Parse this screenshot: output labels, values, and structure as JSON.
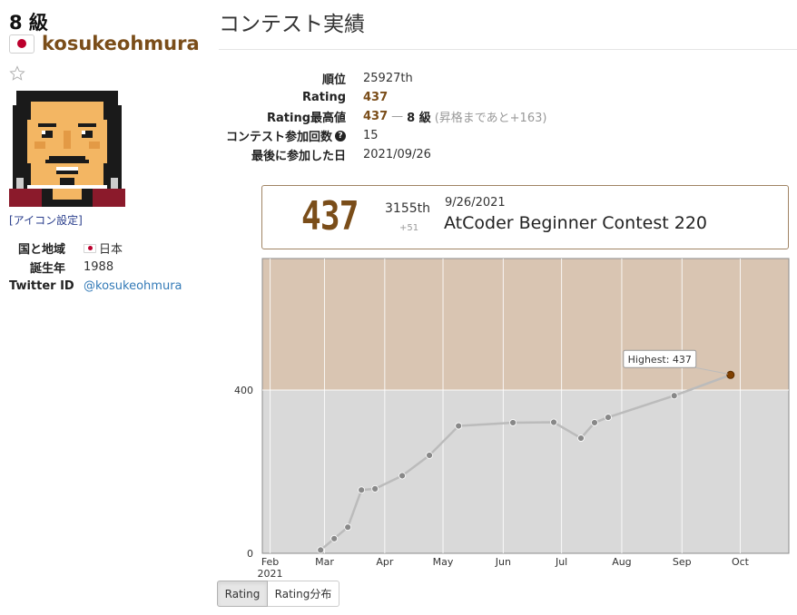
{
  "profile": {
    "grade": "8 級",
    "username": "kosukeohmura",
    "icon_setting_label": "[アイコン設定]",
    "fields": [
      {
        "key": "国と地域",
        "value": "日本",
        "flag": true
      },
      {
        "key": "誕生年",
        "value": "1988"
      },
      {
        "key": "Twitter ID",
        "value": "@kosukeohmura",
        "link": true
      }
    ]
  },
  "page": {
    "title": "コンテスト実績"
  },
  "stats": {
    "rank_label": "順位",
    "rank_value": "25927th",
    "rating_label": "Rating",
    "rating_value": "437",
    "max_label": "Rating最高値",
    "max_value": "437",
    "max_dash": "—",
    "max_grade": "8 級",
    "max_note": "(昇格まであと+163)",
    "count_label": "コンテスト参加回数",
    "count_value": "15",
    "last_label": "最後に参加した日",
    "last_value": "2021/09/26"
  },
  "info_box": {
    "rating": "437",
    "place": "3155th",
    "diff": "+51",
    "date": "9/26/2021",
    "contest": "AtCoder Beginner Contest 220"
  },
  "tabs": [
    {
      "label": "Rating",
      "active": true
    },
    {
      "label": "Rating分布",
      "active": false
    }
  ],
  "chart_data": {
    "type": "line",
    "x_ticks": [
      {
        "date": "2021-02-01",
        "label": "Feb",
        "sublabel": "2021"
      },
      {
        "date": "2021-03-01",
        "label": "Mar"
      },
      {
        "date": "2021-04-01",
        "label": "Apr"
      },
      {
        "date": "2021-05-01",
        "label": "May"
      },
      {
        "date": "2021-06-01",
        "label": "Jun"
      },
      {
        "date": "2021-07-01",
        "label": "Jul"
      },
      {
        "date": "2021-08-01",
        "label": "Aug"
      },
      {
        "date": "2021-09-01",
        "label": "Sep"
      },
      {
        "date": "2021-10-01",
        "label": "Oct"
      }
    ],
    "y_ticks": [
      0,
      400
    ],
    "ylim": [
      0,
      722
    ],
    "xlim": [
      "2021-01-28",
      "2021-10-26"
    ],
    "band_colors": [
      {
        "from": 0,
        "to": 400,
        "color": "#d9d9d9"
      },
      {
        "from": 400,
        "to": 800,
        "color": "#d9c5b2"
      }
    ],
    "line_color": "#bbbbbb",
    "point_color": "#888888",
    "highlight_color": "#804000",
    "highlight_label": "Highest: 437",
    "series": [
      {
        "values": [
          {
            "date": "2021-02-27",
            "y": 8
          },
          {
            "date": "2021-03-06",
            "y": 36
          },
          {
            "date": "2021-03-13",
            "y": 64
          },
          {
            "date": "2021-03-20",
            "y": 155
          },
          {
            "date": "2021-03-27",
            "y": 158
          },
          {
            "date": "2021-04-10",
            "y": 190
          },
          {
            "date": "2021-04-24",
            "y": 240
          },
          {
            "date": "2021-05-09",
            "y": 312
          },
          {
            "date": "2021-06-06",
            "y": 320
          },
          {
            "date": "2021-06-27",
            "y": 321
          },
          {
            "date": "2021-07-11",
            "y": 282
          },
          {
            "date": "2021-07-18",
            "y": 320
          },
          {
            "date": "2021-07-25",
            "y": 333
          },
          {
            "date": "2021-08-28",
            "y": 386
          },
          {
            "date": "2021-09-26",
            "y": 437
          }
        ]
      }
    ]
  }
}
